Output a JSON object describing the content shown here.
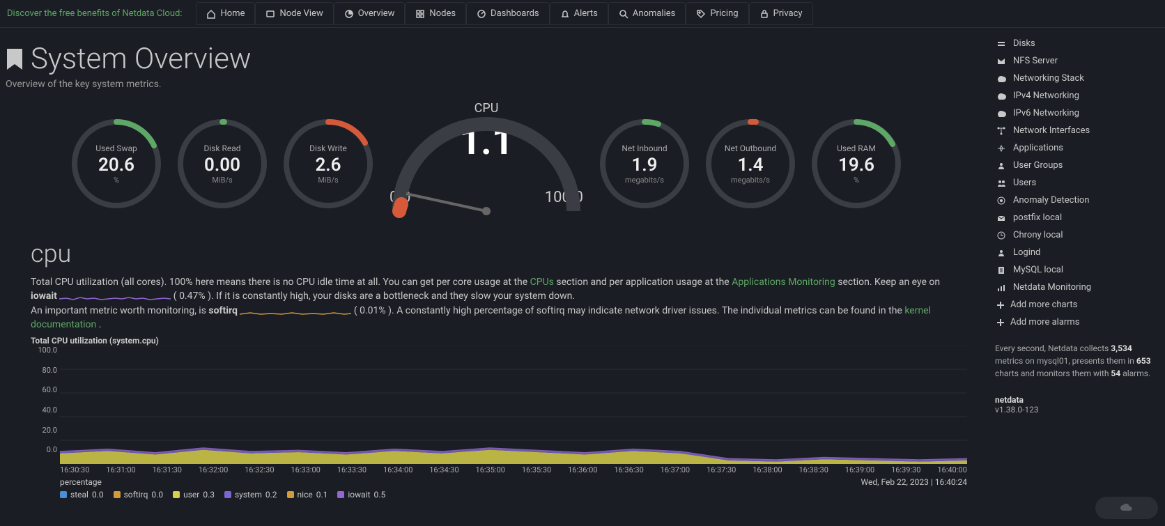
{
  "topbar": {
    "cloud_promo": "Discover the free benefits of Netdata Cloud:",
    "tabs": [
      {
        "label": "Home",
        "icon": "home-icon"
      },
      {
        "label": "Node View",
        "icon": "node-icon"
      },
      {
        "label": "Overview",
        "icon": "overview-icon"
      },
      {
        "label": "Nodes",
        "icon": "nodes-icon"
      },
      {
        "label": "Dashboards",
        "icon": "dashboards-icon"
      },
      {
        "label": "Alerts",
        "icon": "bell-icon"
      },
      {
        "label": "Anomalies",
        "icon": "search-icon"
      },
      {
        "label": "Pricing",
        "icon": "tag-icon"
      },
      {
        "label": "Privacy",
        "icon": "lock-icon"
      }
    ]
  },
  "header": {
    "title": "System Overview",
    "subtitle": "Overview of the key system metrics."
  },
  "gauges": {
    "used_swap": {
      "label": "Used Swap",
      "value": "20.6",
      "unit": "%"
    },
    "disk_read": {
      "label": "Disk Read",
      "value": "0.00",
      "unit": "MiB/s"
    },
    "disk_write": {
      "label": "Disk Write",
      "value": "2.6",
      "unit": "MiB/s"
    },
    "cpu": {
      "label": "CPU",
      "value": "1.1",
      "min": "0.0",
      "max": "100.0",
      "unit": "%"
    },
    "net_in": {
      "label": "Net Inbound",
      "value": "1.9",
      "unit": "megabits/s"
    },
    "net_out": {
      "label": "Net Outbound",
      "value": "1.4",
      "unit": "megabits/s"
    },
    "used_ram": {
      "label": "Used RAM",
      "value": "19.6",
      "unit": "%"
    }
  },
  "cpu_section": {
    "heading": "cpu",
    "desc_part1": "Total CPU utilization (all cores). 100% here means there is no CPU idle time at all. You can get per core usage at the ",
    "link_cpus": "CPUs",
    "desc_part2": " section and per application usage at the ",
    "link_apps": "Applications Monitoring",
    "desc_part3": " section. Keep an eye on ",
    "iowait": "iowait",
    "iowait_pct": "0.47%",
    "desc_part4": "). If it is constantly high, your disks are a bottleneck and they slow your system down.",
    "desc_part5": "An important metric worth monitoring, is ",
    "softirq": "softirq",
    "softirq_pct": "0.01%",
    "desc_part6": "). A constantly high percentage of softirq may indicate network driver issues. The individual metrics can be found in the ",
    "link_kernel": "kernel documentation",
    "desc_part7": "."
  },
  "chart": {
    "title": "Total CPU utilization (system.cpu)",
    "y_label": "percentage",
    "timestamp": "Wed, Feb 22, 2023 | 16:40:24",
    "legend": [
      {
        "name": "steal",
        "value": "0.0",
        "color": "#4a8fd6"
      },
      {
        "name": "softirq",
        "value": "0.0",
        "color": "#d39a3a"
      },
      {
        "name": "user",
        "value": "0.3",
        "color": "#d6cf4a"
      },
      {
        "name": "system",
        "value": "0.2",
        "color": "#7b66d1"
      },
      {
        "name": "nice",
        "value": "0.1",
        "color": "#d39a3a"
      },
      {
        "name": "iowait",
        "value": "0.5",
        "color": "#9466d1"
      }
    ]
  },
  "chart_data": {
    "type": "area",
    "title": "Total CPU utilization (system.cpu)",
    "xlabel": "",
    "ylabel": "percentage",
    "ylim": [
      0,
      100
    ],
    "y_ticks": [
      0.0,
      20.0,
      40.0,
      60.0,
      80.0,
      100.0
    ],
    "x_ticks": [
      "16:30:30",
      "16:31:00",
      "16:31:30",
      "16:32:00",
      "16:32:30",
      "16:33:00",
      "16:33:30",
      "16:34:00",
      "16:34:30",
      "16:35:00",
      "16:35:30",
      "16:36:00",
      "16:36:30",
      "16:37:00",
      "16:37:30",
      "16:38:00",
      "16:38:30",
      "16:39:00",
      "16:39:30",
      "16:40:00"
    ],
    "series": [
      {
        "name": "steal",
        "color": "#4a8fd6",
        "values": [
          0,
          0,
          0,
          0,
          0,
          0,
          0,
          0,
          0,
          0,
          0,
          0,
          0,
          0,
          0,
          0,
          0,
          0,
          0,
          0
        ]
      },
      {
        "name": "softirq",
        "color": "#d39a3a",
        "values": [
          0,
          0,
          0,
          0,
          0,
          0,
          0,
          0,
          0,
          0,
          0,
          0,
          0,
          0,
          0,
          0,
          0,
          0,
          0,
          0
        ]
      },
      {
        "name": "user",
        "color": "#d6cf4a",
        "values": [
          9,
          11,
          8,
          12,
          9,
          10,
          8,
          11,
          9,
          12,
          10,
          8,
          11,
          9,
          3,
          2,
          4,
          3,
          2,
          3
        ]
      },
      {
        "name": "system",
        "color": "#7b66d1",
        "values": [
          1,
          1,
          1,
          1,
          1,
          1,
          1,
          1,
          1,
          1,
          1,
          1,
          1,
          1,
          1,
          1,
          1,
          1,
          1,
          1
        ]
      },
      {
        "name": "nice",
        "color": "#d39a3a",
        "values": [
          0,
          0,
          0,
          0,
          0,
          0,
          0,
          0,
          0,
          0,
          0,
          0,
          0,
          0,
          0,
          0,
          0,
          0,
          0,
          0
        ]
      },
      {
        "name": "iowait",
        "color": "#9466d1",
        "values": [
          1,
          1,
          1,
          1,
          1,
          1,
          1,
          1,
          1,
          1,
          1,
          1,
          1,
          1,
          1,
          1,
          1,
          1,
          1,
          1
        ]
      }
    ]
  },
  "sidebar": {
    "items": [
      {
        "label": "Disks"
      },
      {
        "label": "NFS Server"
      },
      {
        "label": "Networking Stack"
      },
      {
        "label": "IPv4 Networking"
      },
      {
        "label": "IPv6 Networking"
      },
      {
        "label": "Network Interfaces"
      },
      {
        "label": "Applications"
      },
      {
        "label": "User Groups"
      },
      {
        "label": "Users"
      },
      {
        "label": "Anomaly Detection"
      },
      {
        "label": "postfix local"
      },
      {
        "label": "Chrony local"
      },
      {
        "label": "Logind"
      },
      {
        "label": "MySQL local"
      },
      {
        "label": "Netdata Monitoring"
      }
    ],
    "add_charts": "Add more charts",
    "add_alarms": "Add more alarms",
    "info_1a": "Every second, Netdata collects ",
    "info_metrics": "3,534",
    "info_1b": " metrics on mysql01, presents them in ",
    "info_charts": "653",
    "info_1c": " charts and monitors them with ",
    "info_alarms": "54",
    "info_1d": " alarms.",
    "brand": "netdata",
    "version": "v1.38.0-123"
  }
}
